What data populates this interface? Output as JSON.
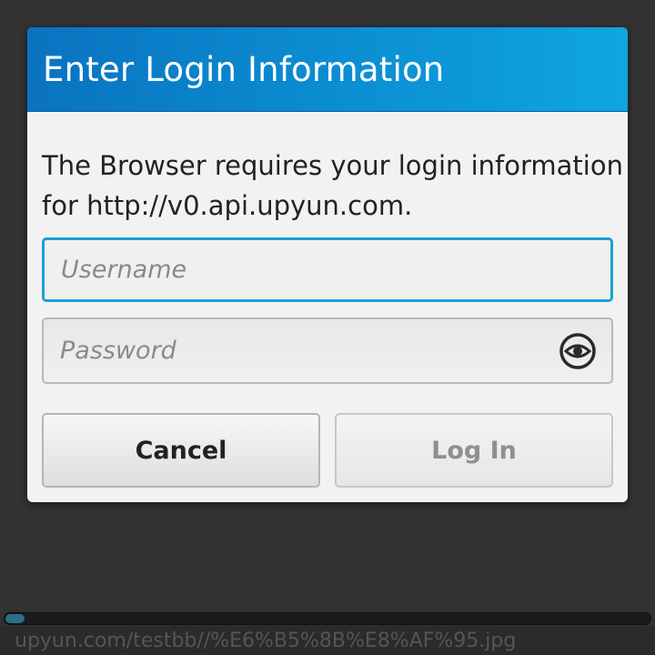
{
  "dialog": {
    "title": "Enter Login Information",
    "message": "The Browser requires your login information for http://v0.api.upyun.com.",
    "username_placeholder": "Username",
    "password_placeholder": "Password",
    "password_reveal_icon": "eye-icon",
    "cancel_label": "Cancel",
    "login_label": "Log In"
  },
  "browser": {
    "url": "upyun.com/testbb//%E6%B5%8B%E8%AF%95.jpg",
    "load_progress": 0.03
  },
  "colors": {
    "header_accent": "#0b8fd3",
    "focus_border": "#1c9fd8",
    "background": "#323232",
    "progress_fill": "#2a6f88"
  }
}
